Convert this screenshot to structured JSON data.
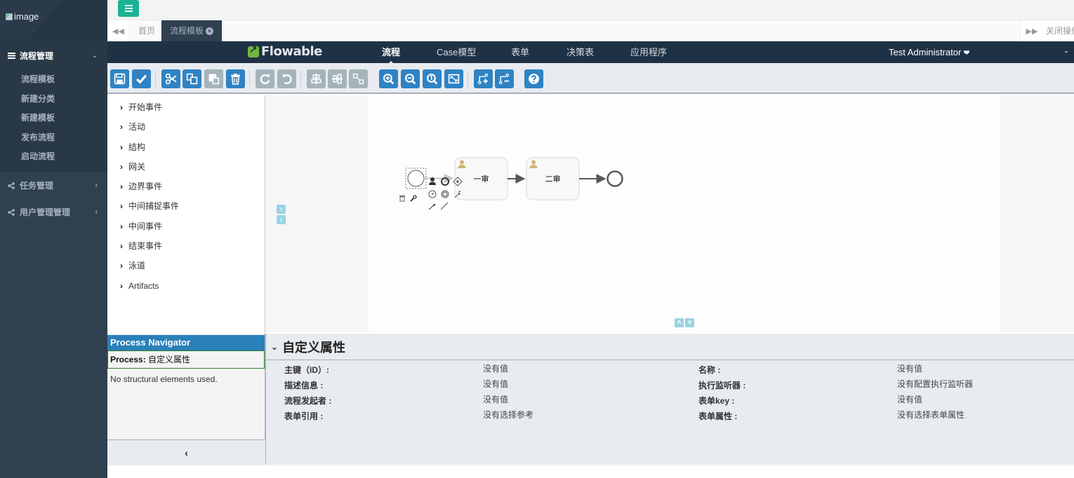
{
  "sidebar": {
    "logo_alt": "image",
    "groups": [
      {
        "label": "流程管理",
        "icon": "list-icon",
        "expanded": true,
        "items": [
          "流程模板",
          "新建分类",
          "新建模板",
          "发布流程",
          "启动流程"
        ]
      },
      {
        "label": "任务管理",
        "icon": "share-icon",
        "expanded": false
      },
      {
        "label": "用户管理管理",
        "icon": "share-icon",
        "expanded": false
      }
    ]
  },
  "topbar": {
    "menu_toggle_icon": "hamburger-icon"
  },
  "tabs": {
    "prev_icon": "double-left-icon",
    "items": [
      {
        "label": "首页",
        "active": false
      },
      {
        "label": "流程模板",
        "active": true,
        "closable": true
      }
    ],
    "next_icon": "double-right-icon",
    "close_ops_label": "关闭操作"
  },
  "flowable_header": {
    "logo_text": "Flowable",
    "nav": [
      {
        "label": "流程",
        "active": true
      },
      {
        "label": "Case模型",
        "active": false
      },
      {
        "label": "表单",
        "active": false
      },
      {
        "label": "决策表",
        "active": false
      },
      {
        "label": "应用程序",
        "active": false
      }
    ],
    "user": "Test Administrator",
    "user_icon": "heart-chevron-icon"
  },
  "toolbar": {
    "buttons": [
      {
        "name": "save",
        "icon": "save-icon",
        "enabled": true
      },
      {
        "name": "validate",
        "icon": "check-icon",
        "enabled": true
      },
      {
        "name": "cut",
        "icon": "scissors-icon",
        "enabled": true
      },
      {
        "name": "copy",
        "icon": "copy-icon",
        "enabled": true
      },
      {
        "name": "paste",
        "icon": "paste-icon",
        "enabled": false
      },
      {
        "name": "delete",
        "icon": "trash-icon",
        "enabled": true
      },
      {
        "name": "redo",
        "icon": "redo-icon",
        "enabled": false
      },
      {
        "name": "undo",
        "icon": "undo-icon",
        "enabled": false
      },
      {
        "name": "align-horizontal",
        "icon": "align-horizontal-icon",
        "enabled": false
      },
      {
        "name": "align-vertical",
        "icon": "align-vertical-icon",
        "enabled": false
      },
      {
        "name": "same-size",
        "icon": "same-size-icon",
        "enabled": false
      },
      {
        "name": "zoom-in",
        "icon": "zoom-in-icon",
        "enabled": true
      },
      {
        "name": "zoom-out",
        "icon": "zoom-out-icon",
        "enabled": true
      },
      {
        "name": "zoom-actual",
        "icon": "zoom-actual-icon",
        "enabled": true
      },
      {
        "name": "zoom-fit",
        "icon": "zoom-fit-icon",
        "enabled": true
      },
      {
        "name": "add-bendpoint",
        "icon": "add-bendpoint-icon",
        "enabled": true
      },
      {
        "name": "remove-bendpoint",
        "icon": "remove-bendpoint-icon",
        "enabled": true
      },
      {
        "name": "help",
        "icon": "help-icon",
        "enabled": true
      }
    ]
  },
  "palette": {
    "groups": [
      "开始事件",
      "活动",
      "结构",
      "网关",
      "边界事件",
      "中间捕捉事件",
      "中间事件",
      "结束事件",
      "泳道",
      "Artifacts"
    ]
  },
  "diagram": {
    "start_event": {
      "selected": true
    },
    "tasks": [
      {
        "label": "一审",
        "type": "user-task"
      },
      {
        "label": "二审",
        "type": "user-task"
      }
    ],
    "end_event": {},
    "quick_menu_icons": [
      "user-task-icon",
      "intermediate-event-icon",
      "gateway-icon",
      "timer-event-icon",
      "end-event-icon",
      "text-annotation-icon",
      "delete-icon",
      "wrench-icon",
      "sequence-flow-icon",
      "association-icon"
    ]
  },
  "navigator": {
    "title": "Process Navigator",
    "process_label": "Process:",
    "process_name": "自定义属性",
    "empty_text": "No structural elements used."
  },
  "properties": {
    "title": "自定义属性",
    "left": [
      {
        "label": "主键（ID）:",
        "value": "没有值"
      },
      {
        "label": "描述信息 :",
        "value": "没有值"
      },
      {
        "label": "流程发起者 :",
        "value": "没有值"
      },
      {
        "label": "表单引用 :",
        "value": "没有选择参考"
      }
    ],
    "right": [
      {
        "label": "名称 :",
        "value": "没有值"
      },
      {
        "label": "执行监听器 :",
        "value": "没有配置执行监听器"
      },
      {
        "label": "表单key :",
        "value": "没有值"
      },
      {
        "label": "表单属性 :",
        "value": "没有选择表单属性"
      }
    ]
  }
}
